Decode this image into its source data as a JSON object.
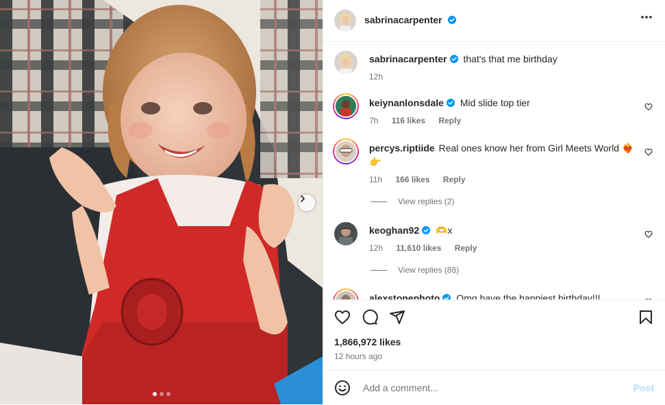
{
  "post": {
    "author": "sabrinacarpenter",
    "more_icon": "more-horizontal-icon",
    "carousel": {
      "slides": 3,
      "active": 0,
      "next_icon": "chevron-right-icon"
    }
  },
  "caption": {
    "username": "sabrinacarpenter",
    "text": "that's that me birthday",
    "time": "12h"
  },
  "comments": [
    {
      "username": "keiynanlonsdale",
      "text": "Mid slide top tier",
      "time": "7h",
      "likes": "116 likes",
      "reply": "Reply"
    },
    {
      "username": "percys.riptiide",
      "text": "Real ones know her from Girl Meets World ❤️‍🔥 👉",
      "time": "11h",
      "likes": "166 likes",
      "reply": "Reply",
      "view_replies": "View replies (2)"
    },
    {
      "username": "keoghan92",
      "text": "🫶x",
      "time": "12h",
      "likes": "11,610 likes",
      "reply": "Reply",
      "view_replies": "View replies (88)"
    },
    {
      "username": "alexstonephoto",
      "text": "Omg have the happiest birthday!!!"
    }
  ],
  "stats": {
    "likes": "1,866,972 likes",
    "posted": "12 hours ago"
  },
  "add_comment": {
    "placeholder": "Add a comment...",
    "post_label": "Post"
  },
  "colors": {
    "verified": "#0095f6",
    "link": "#0095f6",
    "post_disabled": "#b3dbff"
  }
}
